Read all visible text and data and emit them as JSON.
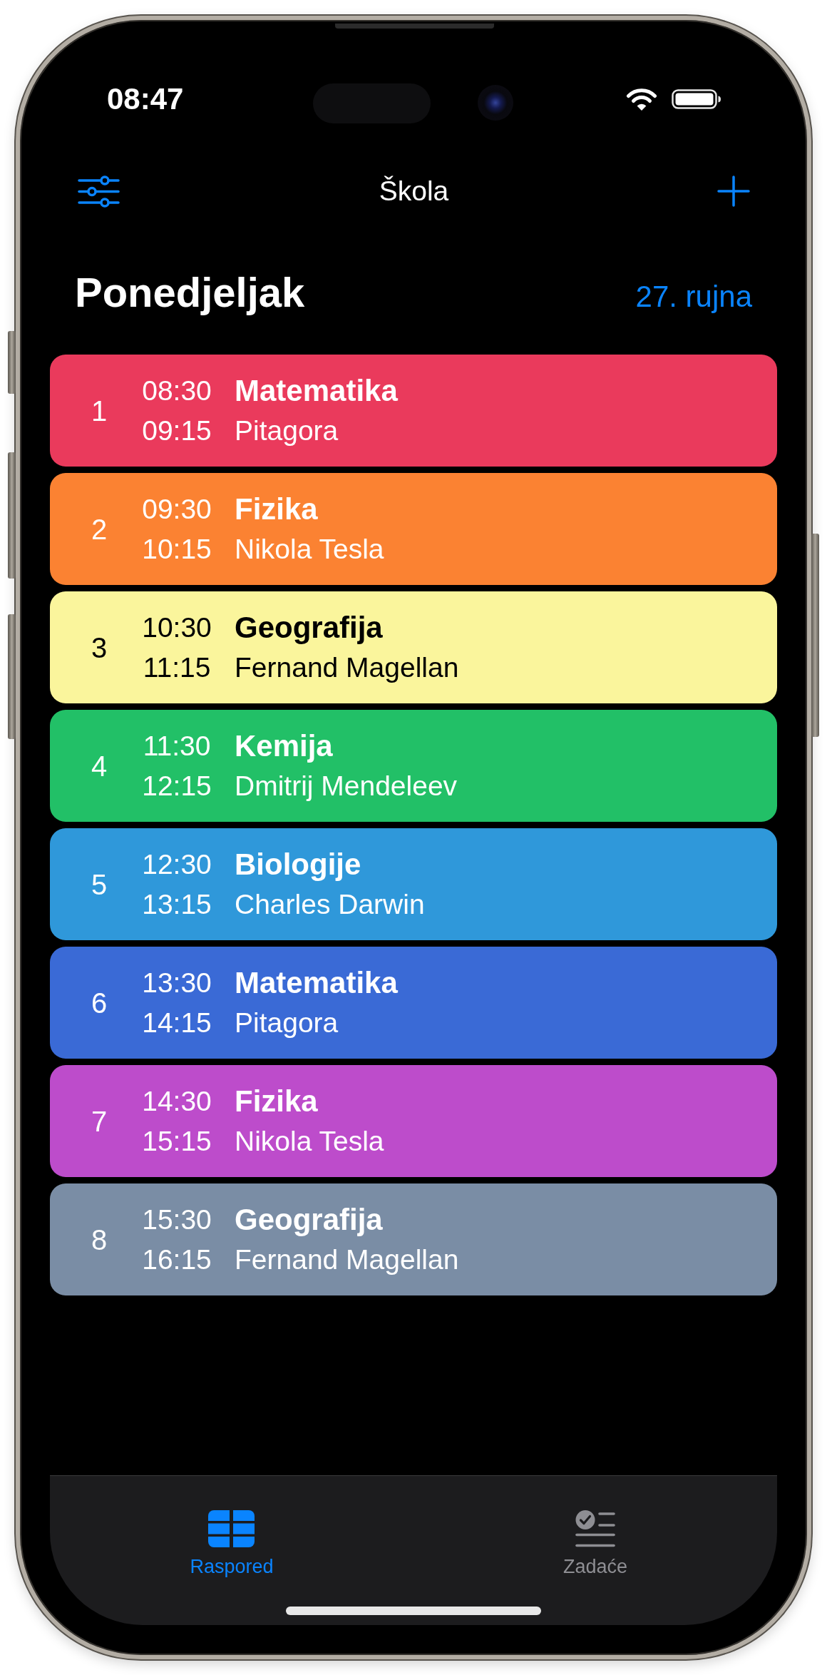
{
  "status_bar": {
    "time": "08:47"
  },
  "nav_bar": {
    "title": "Škola"
  },
  "day_header": {
    "day": "Ponedjeljak",
    "date": "27. rujna"
  },
  "lessons": [
    {
      "number": "1",
      "start": "08:30",
      "end": "09:15",
      "subject": "Matematika",
      "teacher": "Pitagora",
      "color": "#ea3a5c"
    },
    {
      "number": "2",
      "start": "09:30",
      "end": "10:15",
      "subject": "Fizika",
      "teacher": "Nikola Tesla",
      "color": "#fb8232"
    },
    {
      "number": "3",
      "start": "10:30",
      "end": "11:15",
      "subject": "Geografija",
      "teacher": "Fernand Magellan",
      "color": "#faf59c"
    },
    {
      "number": "4",
      "start": "11:30",
      "end": "12:15",
      "subject": "Kemija",
      "teacher": "Dmitrij Mendeleev",
      "color": "#22c067"
    },
    {
      "number": "5",
      "start": "12:30",
      "end": "13:15",
      "subject": "Biologije",
      "teacher": "Charles Darwin",
      "color": "#2f98da"
    },
    {
      "number": "6",
      "start": "13:30",
      "end": "14:15",
      "subject": "Matematika",
      "teacher": "Pitagora",
      "color": "#3a6ad6"
    },
    {
      "number": "7",
      "start": "14:30",
      "end": "15:15",
      "subject": "Fizika",
      "teacher": "Nikola Tesla",
      "color": "#bd4ccb"
    },
    {
      "number": "8",
      "start": "15:30",
      "end": "16:15",
      "subject": "Geografija",
      "teacher": "Fernand Magellan",
      "color": "#7a8da5"
    }
  ],
  "tab_bar": {
    "tabs": [
      {
        "kind": "schedule",
        "label": "Raspored",
        "selected": true
      },
      {
        "kind": "tasks",
        "label": "Zadaće",
        "selected": false
      }
    ]
  }
}
